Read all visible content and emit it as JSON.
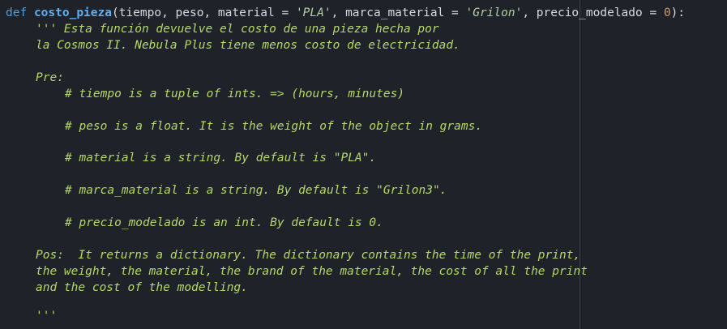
{
  "code": {
    "signature": {
      "keyword": "def",
      "function_name": "costo_pieza",
      "open": "(tiempo, peso, material = ",
      "default_material": "'PLA'",
      "mid1": ", marca_material = ",
      "default_brand": "'Grilon'",
      "mid2": ", precio_modelado = ",
      "default_price": "0",
      "close": "):"
    },
    "docstring": {
      "line1": "''' Esta función devuelve el costo de una pieza hecha por",
      "line2": "la Cosmos II. Nebula Plus tiene menos costo de electricidad.",
      "pre_label": "Pre:",
      "pre_items": [
        "# tiempo is a tuple of ints. => (hours, minutes)",
        "# peso is a float. It is the weight of the object in grams.",
        "# material is a string. By default is \"PLA\".",
        "# marca_material is a string. By default is \"Grilon3\".",
        "# precio_modelado is an int. By default is 0."
      ],
      "pos_line1": "Pos:  It returns a dictionary. The dictionary contains the time of the print,",
      "pos_line2": "the weight, the material, the brand of the material, the cost of all the print",
      "pos_line3": "and the cost of the modelling.",
      "closing": "'''"
    }
  },
  "colors": {
    "background": "#1f2228",
    "keyword": "#569cd6",
    "function": "#61afef",
    "docstring": "#b5d86a",
    "number": "#d19a66"
  }
}
